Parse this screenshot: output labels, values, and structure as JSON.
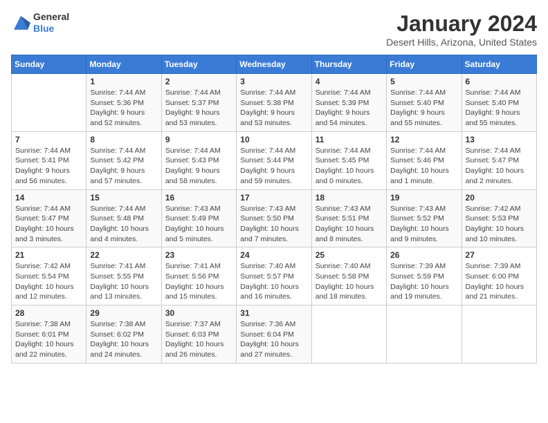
{
  "header": {
    "logo": {
      "general": "General",
      "blue": "Blue"
    },
    "title": "January 2024",
    "location": "Desert Hills, Arizona, United States"
  },
  "calendar": {
    "days_of_week": [
      "Sunday",
      "Monday",
      "Tuesday",
      "Wednesday",
      "Thursday",
      "Friday",
      "Saturday"
    ],
    "weeks": [
      [
        {
          "day": "",
          "info": ""
        },
        {
          "day": "1",
          "info": "Sunrise: 7:44 AM\nSunset: 5:36 PM\nDaylight: 9 hours\nand 52 minutes."
        },
        {
          "day": "2",
          "info": "Sunrise: 7:44 AM\nSunset: 5:37 PM\nDaylight: 9 hours\nand 53 minutes."
        },
        {
          "day": "3",
          "info": "Sunrise: 7:44 AM\nSunset: 5:38 PM\nDaylight: 9 hours\nand 53 minutes."
        },
        {
          "day": "4",
          "info": "Sunrise: 7:44 AM\nSunset: 5:39 PM\nDaylight: 9 hours\nand 54 minutes."
        },
        {
          "day": "5",
          "info": "Sunrise: 7:44 AM\nSunset: 5:40 PM\nDaylight: 9 hours\nand 55 minutes."
        },
        {
          "day": "6",
          "info": "Sunrise: 7:44 AM\nSunset: 5:40 PM\nDaylight: 9 hours\nand 55 minutes."
        }
      ],
      [
        {
          "day": "7",
          "info": "Sunrise: 7:44 AM\nSunset: 5:41 PM\nDaylight: 9 hours\nand 56 minutes."
        },
        {
          "day": "8",
          "info": "Sunrise: 7:44 AM\nSunset: 5:42 PM\nDaylight: 9 hours\nand 57 minutes."
        },
        {
          "day": "9",
          "info": "Sunrise: 7:44 AM\nSunset: 5:43 PM\nDaylight: 9 hours\nand 58 minutes."
        },
        {
          "day": "10",
          "info": "Sunrise: 7:44 AM\nSunset: 5:44 PM\nDaylight: 9 hours\nand 59 minutes."
        },
        {
          "day": "11",
          "info": "Sunrise: 7:44 AM\nSunset: 5:45 PM\nDaylight: 10 hours\nand 0 minutes."
        },
        {
          "day": "12",
          "info": "Sunrise: 7:44 AM\nSunset: 5:46 PM\nDaylight: 10 hours\nand 1 minute."
        },
        {
          "day": "13",
          "info": "Sunrise: 7:44 AM\nSunset: 5:47 PM\nDaylight: 10 hours\nand 2 minutes."
        }
      ],
      [
        {
          "day": "14",
          "info": "Sunrise: 7:44 AM\nSunset: 5:47 PM\nDaylight: 10 hours\nand 3 minutes."
        },
        {
          "day": "15",
          "info": "Sunrise: 7:44 AM\nSunset: 5:48 PM\nDaylight: 10 hours\nand 4 minutes."
        },
        {
          "day": "16",
          "info": "Sunrise: 7:43 AM\nSunset: 5:49 PM\nDaylight: 10 hours\nand 5 minutes."
        },
        {
          "day": "17",
          "info": "Sunrise: 7:43 AM\nSunset: 5:50 PM\nDaylight: 10 hours\nand 7 minutes."
        },
        {
          "day": "18",
          "info": "Sunrise: 7:43 AM\nSunset: 5:51 PM\nDaylight: 10 hours\nand 8 minutes."
        },
        {
          "day": "19",
          "info": "Sunrise: 7:43 AM\nSunset: 5:52 PM\nDaylight: 10 hours\nand 9 minutes."
        },
        {
          "day": "20",
          "info": "Sunrise: 7:42 AM\nSunset: 5:53 PM\nDaylight: 10 hours\nand 10 minutes."
        }
      ],
      [
        {
          "day": "21",
          "info": "Sunrise: 7:42 AM\nSunset: 5:54 PM\nDaylight: 10 hours\nand 12 minutes."
        },
        {
          "day": "22",
          "info": "Sunrise: 7:41 AM\nSunset: 5:55 PM\nDaylight: 10 hours\nand 13 minutes."
        },
        {
          "day": "23",
          "info": "Sunrise: 7:41 AM\nSunset: 5:56 PM\nDaylight: 10 hours\nand 15 minutes."
        },
        {
          "day": "24",
          "info": "Sunrise: 7:40 AM\nSunset: 5:57 PM\nDaylight: 10 hours\nand 16 minutes."
        },
        {
          "day": "25",
          "info": "Sunrise: 7:40 AM\nSunset: 5:58 PM\nDaylight: 10 hours\nand 18 minutes."
        },
        {
          "day": "26",
          "info": "Sunrise: 7:39 AM\nSunset: 5:59 PM\nDaylight: 10 hours\nand 19 minutes."
        },
        {
          "day": "27",
          "info": "Sunrise: 7:39 AM\nSunset: 6:00 PM\nDaylight: 10 hours\nand 21 minutes."
        }
      ],
      [
        {
          "day": "28",
          "info": "Sunrise: 7:38 AM\nSunset: 6:01 PM\nDaylight: 10 hours\nand 22 minutes."
        },
        {
          "day": "29",
          "info": "Sunrise: 7:38 AM\nSunset: 6:02 PM\nDaylight: 10 hours\nand 24 minutes."
        },
        {
          "day": "30",
          "info": "Sunrise: 7:37 AM\nSunset: 6:03 PM\nDaylight: 10 hours\nand 26 minutes."
        },
        {
          "day": "31",
          "info": "Sunrise: 7:36 AM\nSunset: 6:04 PM\nDaylight: 10 hours\nand 27 minutes."
        },
        {
          "day": "",
          "info": ""
        },
        {
          "day": "",
          "info": ""
        },
        {
          "day": "",
          "info": ""
        }
      ]
    ]
  }
}
